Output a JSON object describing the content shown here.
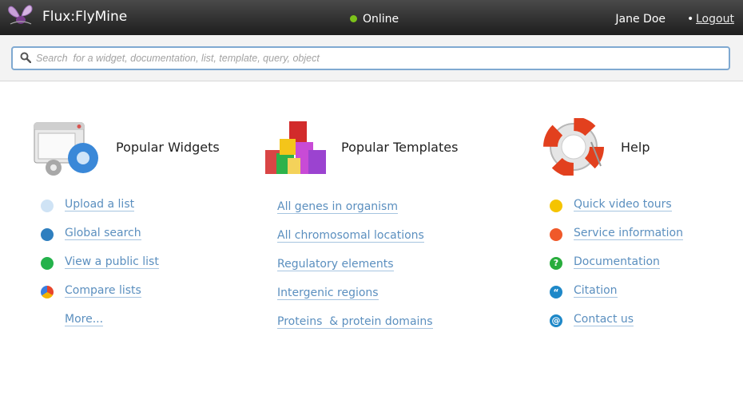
{
  "header": {
    "app_title": "Flux:FlyMine",
    "status": "Online",
    "user_name": "Jane Doe",
    "separator": "•",
    "logout_label": "Logout"
  },
  "search": {
    "placeholder": "Search  for a widget, documentation, list, template, query, object"
  },
  "widgets": {
    "title": "Popular Widgets",
    "links": [
      "Upload a list",
      "Global search",
      "View a public list",
      "Compare lists",
      "More..."
    ]
  },
  "templates": {
    "title": "Popular Templates",
    "links": [
      "All genes in organism",
      "All chromosomal locations",
      "Regulatory elements",
      "Intergenic regions",
      "Proteins  & protein domains"
    ]
  },
  "help": {
    "title": "Help",
    "links": [
      "Quick video tours",
      "Service information",
      "Documentation",
      "Citation",
      "Contact us"
    ]
  },
  "colors": {
    "link": "#5b8fbf",
    "status_dot": "#7cc21a",
    "search_border": "#7fa9d1"
  }
}
